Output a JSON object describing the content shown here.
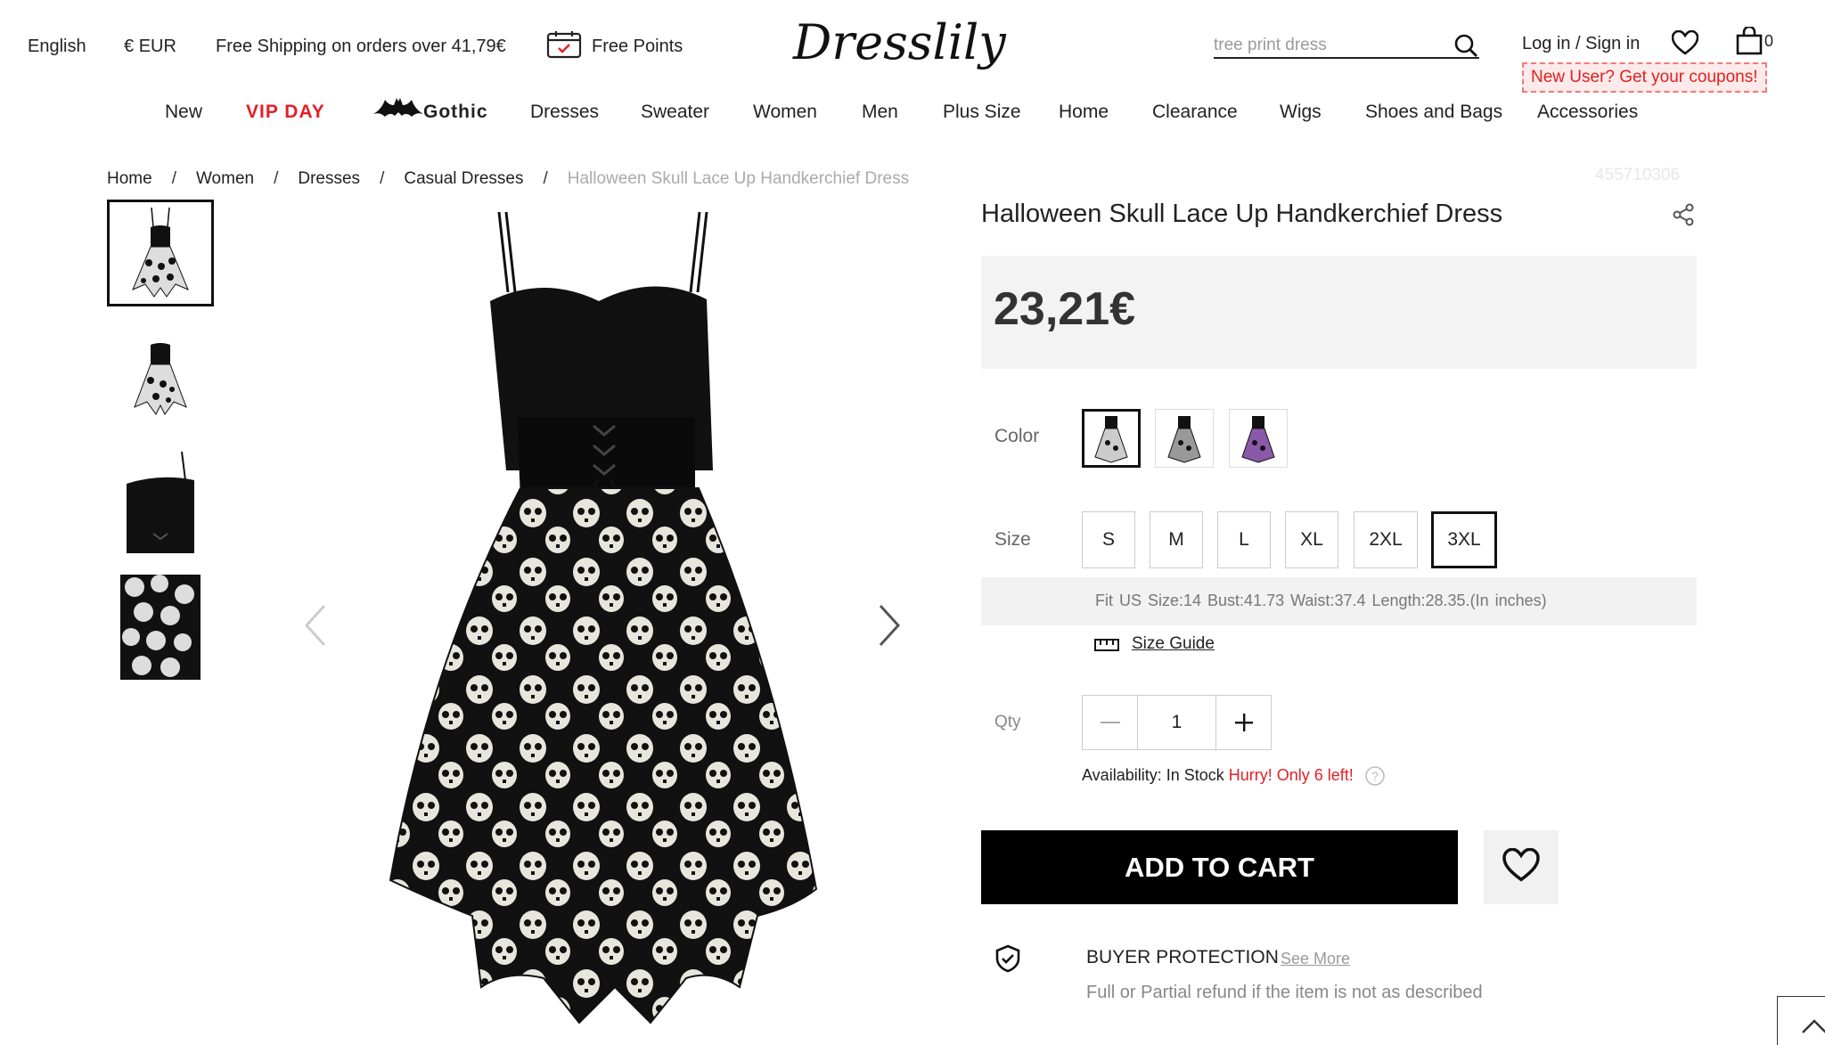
{
  "topbar": {
    "language": "English",
    "currency_symbol": "€",
    "currency": "EUR",
    "shipping": "Free Shipping on orders over 41,79€",
    "points": "Free Points",
    "search_placeholder": "tree print dress",
    "login": "Log in / Sign in",
    "cart_count": "0",
    "coupon": "New User? Get your coupons!",
    "logo_text": "Dresslily"
  },
  "nav": {
    "items": [
      "New",
      "VIP DAY",
      "Gothic",
      "Dresses",
      "Sweater",
      "Women",
      "Men",
      "Plus Size",
      "Home",
      "Clearance",
      "Wigs",
      "Shoes and Bags",
      "Accessories"
    ]
  },
  "breadcrumb": {
    "items": [
      "Home",
      "Women",
      "Dresses",
      "Casual Dresses"
    ],
    "sep": "/",
    "current": "Halloween Skull Lace Up Handkerchief Dress"
  },
  "product": {
    "sku": "455710306",
    "title": "Halloween Skull Lace Up Handkerchief Dress",
    "price": "23,21€",
    "color_label": "Color",
    "size_label": "Size",
    "sizes": [
      "S",
      "M",
      "L",
      "XL",
      "2XL",
      "3XL"
    ],
    "selected_size": "3XL",
    "fit": "Fit US Size:14   Bust:41.73   Waist:37.4   Length:28.35.(In inches)",
    "size_guide": "Size Guide",
    "qty_label": "Qty",
    "qty": "1",
    "availability_prefix": "Availability: In Stock",
    "availability_hurry": "Hurry! Only 6 left!",
    "add_to_cart": "ADD TO CART",
    "buyer_protection": "BUYER PROTECTION",
    "see_more": "See More",
    "protection_desc": "Full or Partial refund if the item is not as described"
  },
  "colors": {
    "accent_red": "#e41f27",
    "button_black": "#000000",
    "price_bg": "#f3f3f3"
  }
}
